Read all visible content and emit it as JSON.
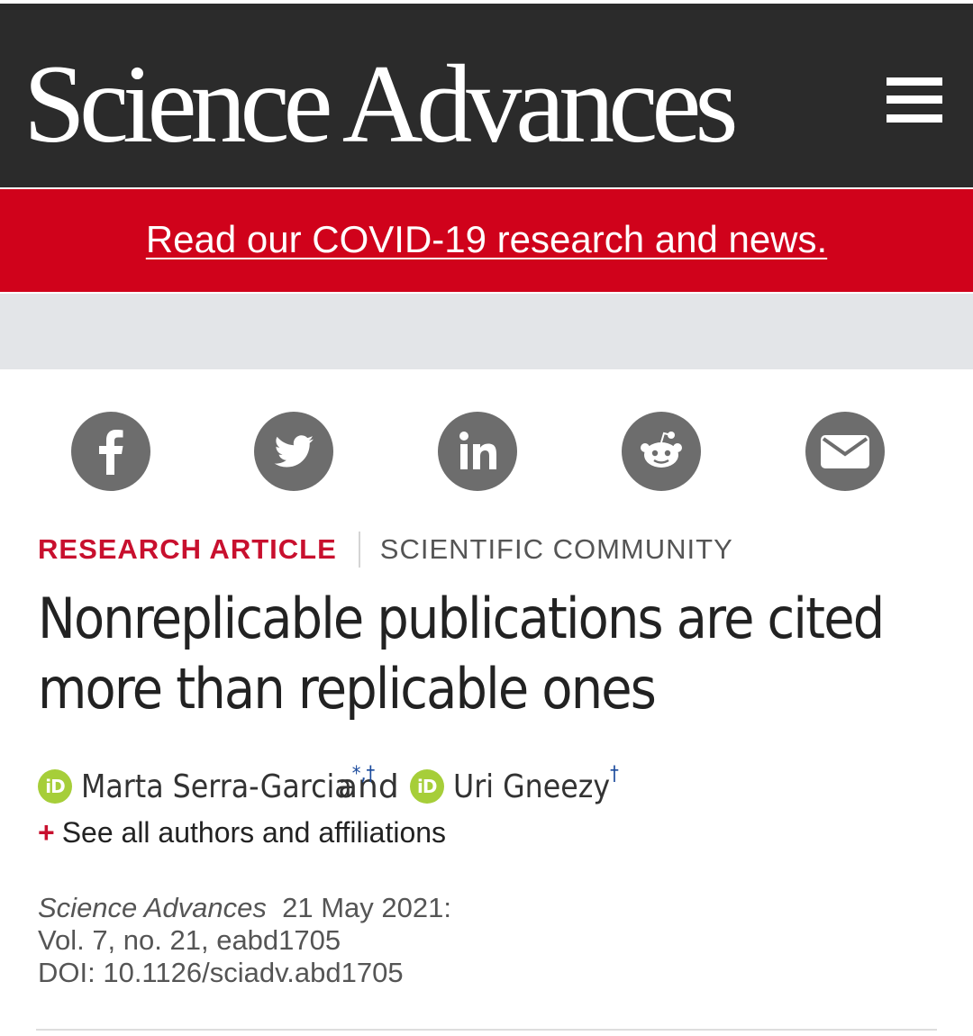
{
  "header": {
    "logo_text": "Science Advances",
    "menu_icon": "hamburger-menu-icon"
  },
  "banner": {
    "link_text": "Read our COVID-19 research and news.",
    "color": "#d0021b"
  },
  "share": {
    "icons": [
      "facebook-icon",
      "twitter-icon",
      "linkedin-icon",
      "reddit-icon",
      "email-icon"
    ],
    "color": "#6d6d6d"
  },
  "article": {
    "type": "RESEARCH ARTICLE",
    "subject": "SCIENTIFIC COMMUNITY",
    "title_line1": "Nonreplicable publications are cited",
    "title_line2": "more than replicable ones",
    "authors": [
      {
        "name": "Marta Serra-Garcia",
        "marks": "*,†"
      },
      {
        "name": "Uri Gneezy",
        "marks": "†"
      }
    ],
    "and_text": "and",
    "orcid_label": "iD",
    "see_all": "See all authors and affiliations",
    "see_all_plus": "+",
    "journal": "Science Advances",
    "date": "21 May 2021:",
    "volume": "Vol. 7, no. 21, eabd1705",
    "doi": "DOI: 10.1126/sciadv.abd1705"
  }
}
